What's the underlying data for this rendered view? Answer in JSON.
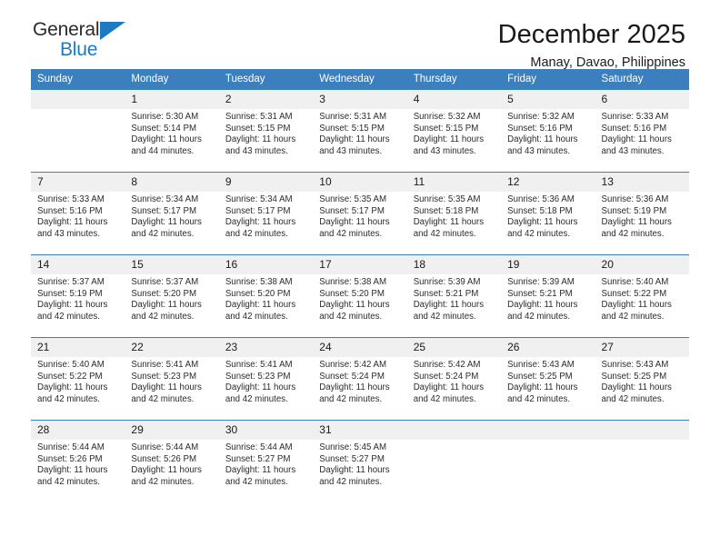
{
  "brand": {
    "line1": "General",
    "line2": "Blue",
    "triangle_color": "#1b7ac2",
    "text_color": "#2a2a2a"
  },
  "header": {
    "title": "December 2025",
    "subtitle": "Manay, Davao, Philippines"
  },
  "theme": {
    "header_bg": "#3b7fbe",
    "header_text": "#ffffff",
    "daynum_bg": "#f0f0f0",
    "cell_bg": "#ffffff",
    "row_border": "#3b7fbe"
  },
  "weekday_headers": [
    "Sunday",
    "Monday",
    "Tuesday",
    "Wednesday",
    "Thursday",
    "Friday",
    "Saturday"
  ],
  "weeks": [
    [
      {
        "day": "",
        "sunrise": "",
        "sunset": "",
        "daylight1": "",
        "daylight2": ""
      },
      {
        "day": "1",
        "sunrise": "Sunrise: 5:30 AM",
        "sunset": "Sunset: 5:14 PM",
        "daylight1": "Daylight: 11 hours",
        "daylight2": "and 44 minutes."
      },
      {
        "day": "2",
        "sunrise": "Sunrise: 5:31 AM",
        "sunset": "Sunset: 5:15 PM",
        "daylight1": "Daylight: 11 hours",
        "daylight2": "and 43 minutes."
      },
      {
        "day": "3",
        "sunrise": "Sunrise: 5:31 AM",
        "sunset": "Sunset: 5:15 PM",
        "daylight1": "Daylight: 11 hours",
        "daylight2": "and 43 minutes."
      },
      {
        "day": "4",
        "sunrise": "Sunrise: 5:32 AM",
        "sunset": "Sunset: 5:15 PM",
        "daylight1": "Daylight: 11 hours",
        "daylight2": "and 43 minutes."
      },
      {
        "day": "5",
        "sunrise": "Sunrise: 5:32 AM",
        "sunset": "Sunset: 5:16 PM",
        "daylight1": "Daylight: 11 hours",
        "daylight2": "and 43 minutes."
      },
      {
        "day": "6",
        "sunrise": "Sunrise: 5:33 AM",
        "sunset": "Sunset: 5:16 PM",
        "daylight1": "Daylight: 11 hours",
        "daylight2": "and 43 minutes."
      }
    ],
    [
      {
        "day": "7",
        "sunrise": "Sunrise: 5:33 AM",
        "sunset": "Sunset: 5:16 PM",
        "daylight1": "Daylight: 11 hours",
        "daylight2": "and 43 minutes."
      },
      {
        "day": "8",
        "sunrise": "Sunrise: 5:34 AM",
        "sunset": "Sunset: 5:17 PM",
        "daylight1": "Daylight: 11 hours",
        "daylight2": "and 42 minutes."
      },
      {
        "day": "9",
        "sunrise": "Sunrise: 5:34 AM",
        "sunset": "Sunset: 5:17 PM",
        "daylight1": "Daylight: 11 hours",
        "daylight2": "and 42 minutes."
      },
      {
        "day": "10",
        "sunrise": "Sunrise: 5:35 AM",
        "sunset": "Sunset: 5:17 PM",
        "daylight1": "Daylight: 11 hours",
        "daylight2": "and 42 minutes."
      },
      {
        "day": "11",
        "sunrise": "Sunrise: 5:35 AM",
        "sunset": "Sunset: 5:18 PM",
        "daylight1": "Daylight: 11 hours",
        "daylight2": "and 42 minutes."
      },
      {
        "day": "12",
        "sunrise": "Sunrise: 5:36 AM",
        "sunset": "Sunset: 5:18 PM",
        "daylight1": "Daylight: 11 hours",
        "daylight2": "and 42 minutes."
      },
      {
        "day": "13",
        "sunrise": "Sunrise: 5:36 AM",
        "sunset": "Sunset: 5:19 PM",
        "daylight1": "Daylight: 11 hours",
        "daylight2": "and 42 minutes."
      }
    ],
    [
      {
        "day": "14",
        "sunrise": "Sunrise: 5:37 AM",
        "sunset": "Sunset: 5:19 PM",
        "daylight1": "Daylight: 11 hours",
        "daylight2": "and 42 minutes."
      },
      {
        "day": "15",
        "sunrise": "Sunrise: 5:37 AM",
        "sunset": "Sunset: 5:20 PM",
        "daylight1": "Daylight: 11 hours",
        "daylight2": "and 42 minutes."
      },
      {
        "day": "16",
        "sunrise": "Sunrise: 5:38 AM",
        "sunset": "Sunset: 5:20 PM",
        "daylight1": "Daylight: 11 hours",
        "daylight2": "and 42 minutes."
      },
      {
        "day": "17",
        "sunrise": "Sunrise: 5:38 AM",
        "sunset": "Sunset: 5:20 PM",
        "daylight1": "Daylight: 11 hours",
        "daylight2": "and 42 minutes."
      },
      {
        "day": "18",
        "sunrise": "Sunrise: 5:39 AM",
        "sunset": "Sunset: 5:21 PM",
        "daylight1": "Daylight: 11 hours",
        "daylight2": "and 42 minutes."
      },
      {
        "day": "19",
        "sunrise": "Sunrise: 5:39 AM",
        "sunset": "Sunset: 5:21 PM",
        "daylight1": "Daylight: 11 hours",
        "daylight2": "and 42 minutes."
      },
      {
        "day": "20",
        "sunrise": "Sunrise: 5:40 AM",
        "sunset": "Sunset: 5:22 PM",
        "daylight1": "Daylight: 11 hours",
        "daylight2": "and 42 minutes."
      }
    ],
    [
      {
        "day": "21",
        "sunrise": "Sunrise: 5:40 AM",
        "sunset": "Sunset: 5:22 PM",
        "daylight1": "Daylight: 11 hours",
        "daylight2": "and 42 minutes."
      },
      {
        "day": "22",
        "sunrise": "Sunrise: 5:41 AM",
        "sunset": "Sunset: 5:23 PM",
        "daylight1": "Daylight: 11 hours",
        "daylight2": "and 42 minutes."
      },
      {
        "day": "23",
        "sunrise": "Sunrise: 5:41 AM",
        "sunset": "Sunset: 5:23 PM",
        "daylight1": "Daylight: 11 hours",
        "daylight2": "and 42 minutes."
      },
      {
        "day": "24",
        "sunrise": "Sunrise: 5:42 AM",
        "sunset": "Sunset: 5:24 PM",
        "daylight1": "Daylight: 11 hours",
        "daylight2": "and 42 minutes."
      },
      {
        "day": "25",
        "sunrise": "Sunrise: 5:42 AM",
        "sunset": "Sunset: 5:24 PM",
        "daylight1": "Daylight: 11 hours",
        "daylight2": "and 42 minutes."
      },
      {
        "day": "26",
        "sunrise": "Sunrise: 5:43 AM",
        "sunset": "Sunset: 5:25 PM",
        "daylight1": "Daylight: 11 hours",
        "daylight2": "and 42 minutes."
      },
      {
        "day": "27",
        "sunrise": "Sunrise: 5:43 AM",
        "sunset": "Sunset: 5:25 PM",
        "daylight1": "Daylight: 11 hours",
        "daylight2": "and 42 minutes."
      }
    ],
    [
      {
        "day": "28",
        "sunrise": "Sunrise: 5:44 AM",
        "sunset": "Sunset: 5:26 PM",
        "daylight1": "Daylight: 11 hours",
        "daylight2": "and 42 minutes."
      },
      {
        "day": "29",
        "sunrise": "Sunrise: 5:44 AM",
        "sunset": "Sunset: 5:26 PM",
        "daylight1": "Daylight: 11 hours",
        "daylight2": "and 42 minutes."
      },
      {
        "day": "30",
        "sunrise": "Sunrise: 5:44 AM",
        "sunset": "Sunset: 5:27 PM",
        "daylight1": "Daylight: 11 hours",
        "daylight2": "and 42 minutes."
      },
      {
        "day": "31",
        "sunrise": "Sunrise: 5:45 AM",
        "sunset": "Sunset: 5:27 PM",
        "daylight1": "Daylight: 11 hours",
        "daylight2": "and 42 minutes."
      },
      {
        "day": "",
        "sunrise": "",
        "sunset": "",
        "daylight1": "",
        "daylight2": ""
      },
      {
        "day": "",
        "sunrise": "",
        "sunset": "",
        "daylight1": "",
        "daylight2": ""
      },
      {
        "day": "",
        "sunrise": "",
        "sunset": "",
        "daylight1": "",
        "daylight2": ""
      }
    ]
  ]
}
